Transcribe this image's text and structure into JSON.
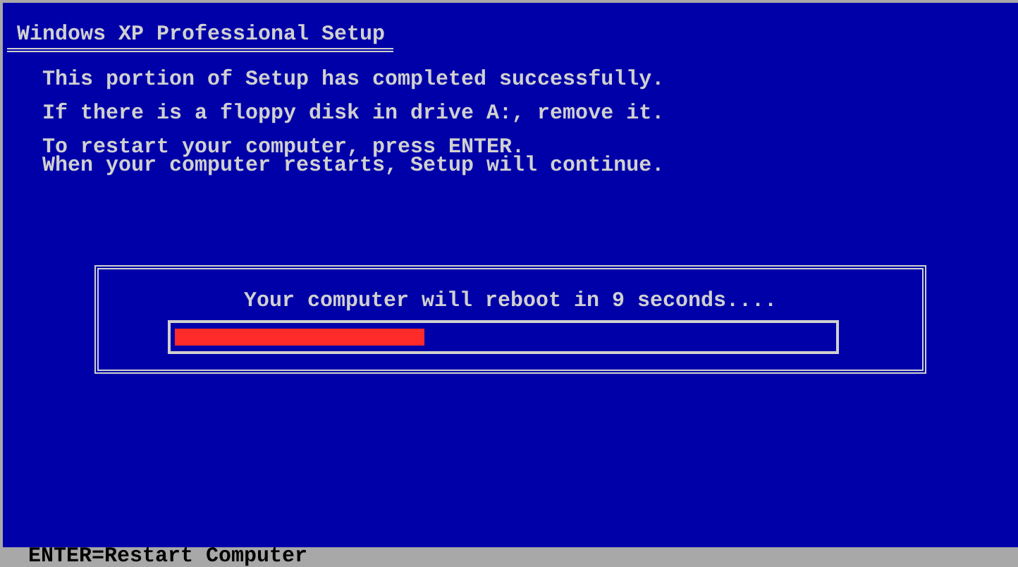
{
  "window": {
    "title": "Windows XP Professional Setup"
  },
  "messages": [
    {
      "lines": [
        "This portion of Setup has completed successfully."
      ]
    },
    {
      "lines": [
        "If there is a floppy disk in drive A:, remove it."
      ]
    },
    {
      "lines": [
        "To restart your computer, press ENTER.",
        "When your computer restarts, Setup will continue."
      ]
    }
  ],
  "reboot_dialog": {
    "message": "Your computer will reboot in 9 seconds....",
    "progress": {
      "level": 0.38
    }
  },
  "status_bar": {
    "text": "ENTER=Restart Computer"
  }
}
